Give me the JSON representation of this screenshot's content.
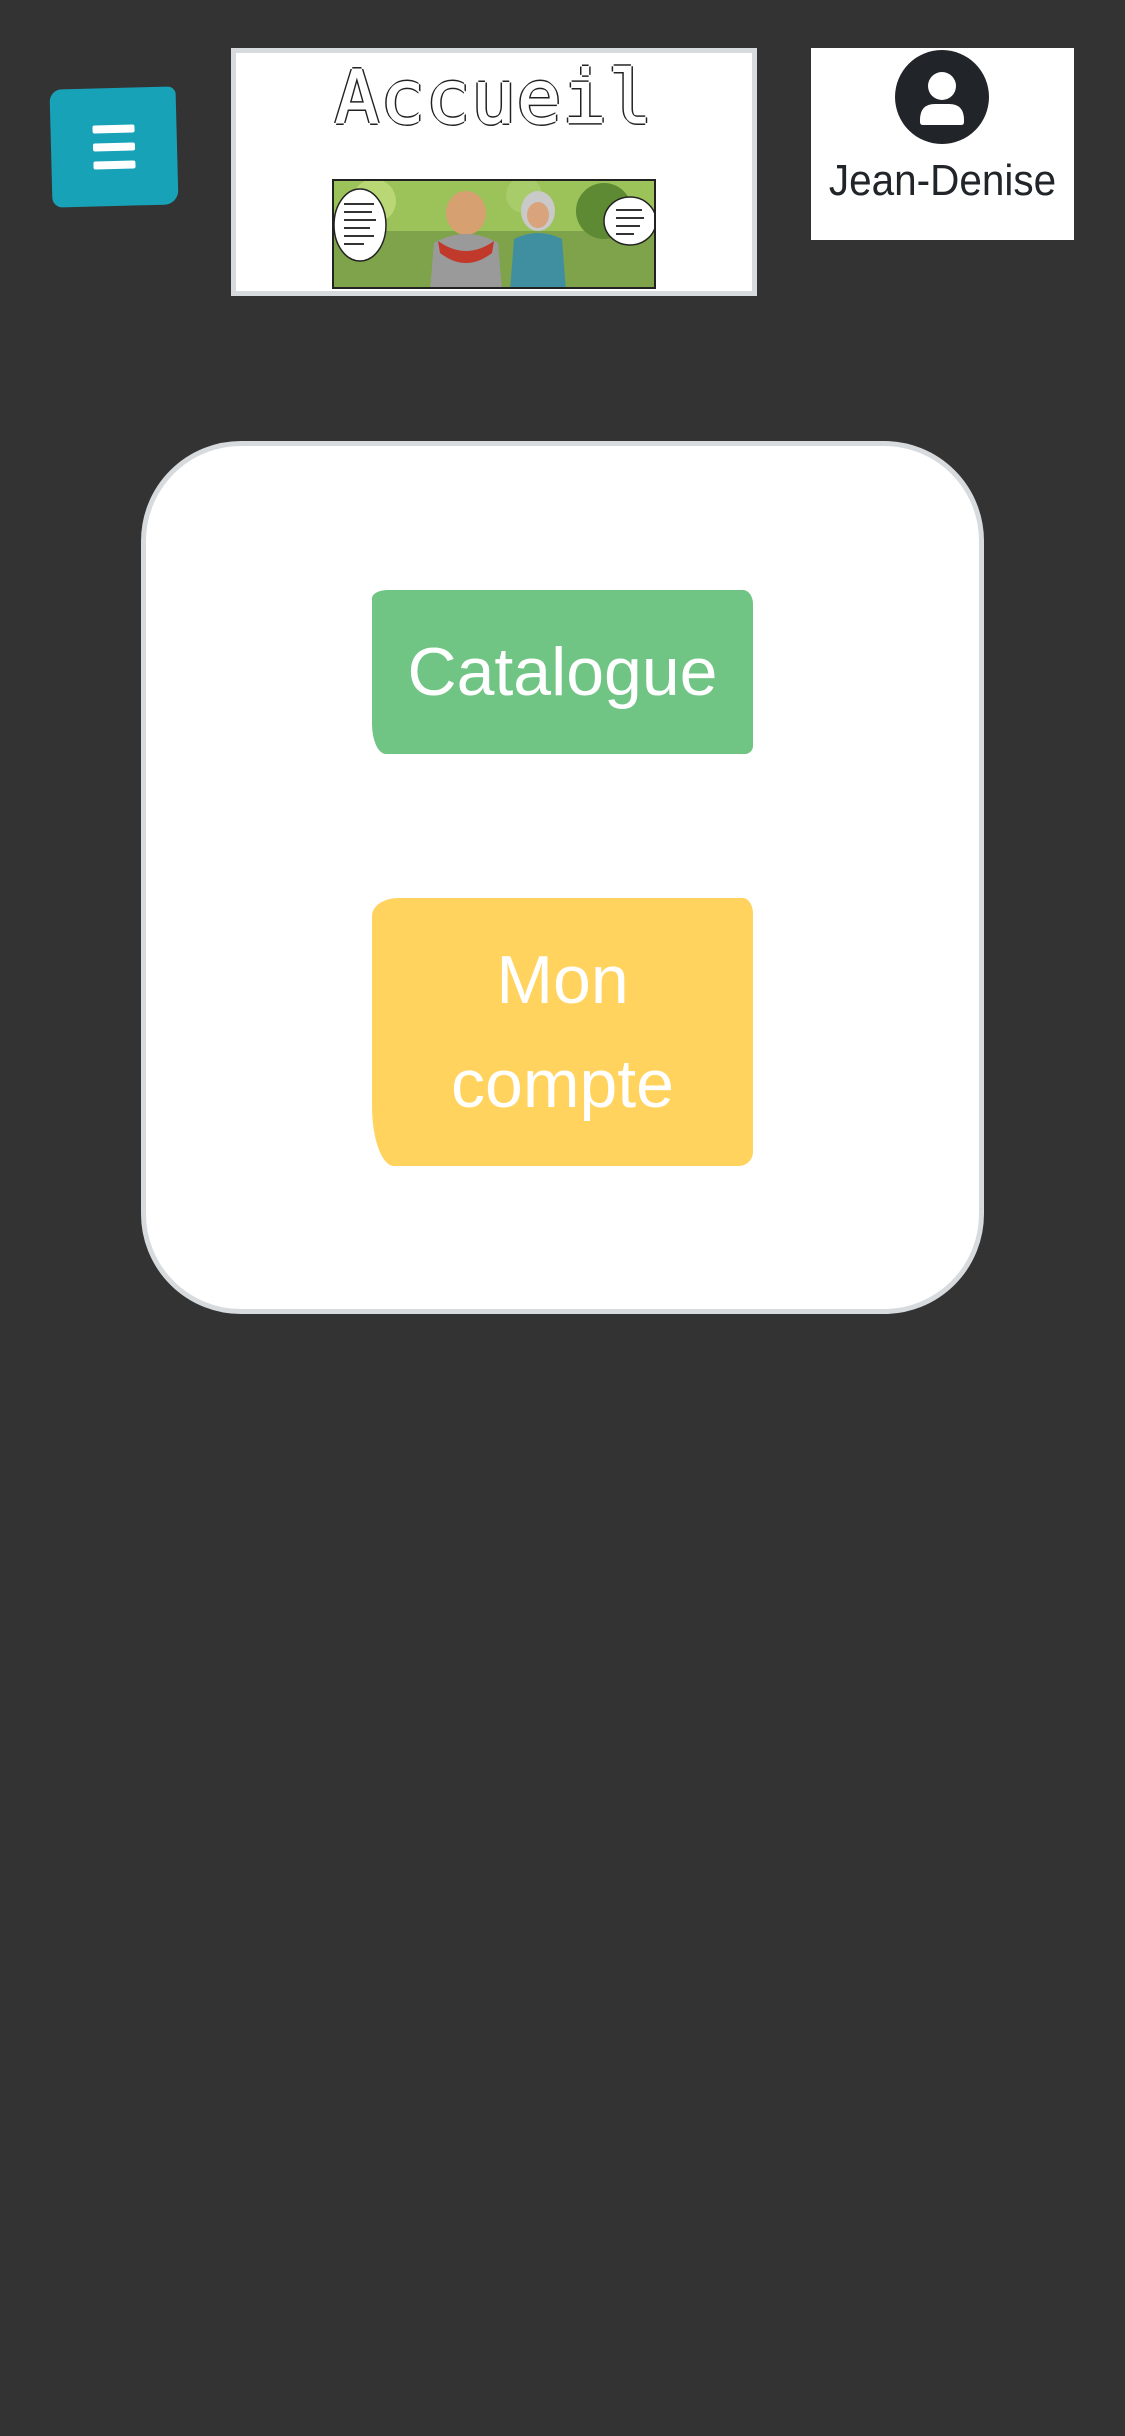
{
  "header": {
    "page_title": "Accueil",
    "menu_icon": "hamburger-menu-icon",
    "user": {
      "name": "Jean-Denise",
      "avatar_icon": "user-avatar-icon"
    }
  },
  "main": {
    "catalogue_label": "Catalogue",
    "account_label_line1": "Mon",
    "account_label_line2": "compte"
  },
  "colors": {
    "background": "#333333",
    "menu_button": "#17a2b8",
    "catalogue_button": "#71c584",
    "account_button": "#ffd35e",
    "card": "#ffffff"
  }
}
